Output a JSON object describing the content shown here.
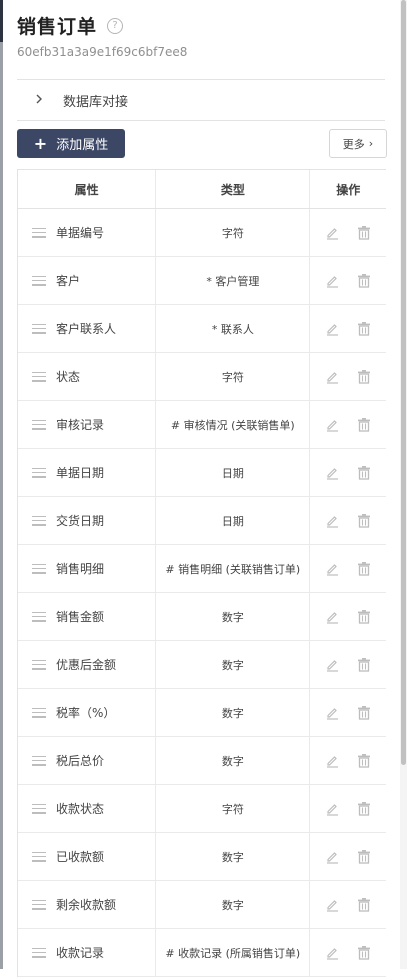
{
  "header": {
    "title": "销售订单",
    "help_icon": "?",
    "record_id": "60efb31a3a9e1f69c6bf7ee8"
  },
  "db_section": {
    "label": "数据库对接",
    "icon": "chevron-right-icon"
  },
  "toolbar": {
    "add_label": "添加属性",
    "add_icon": "+",
    "more_label": "更多",
    "more_icon": "›"
  },
  "table": {
    "headers": {
      "property": "属性",
      "type": "类型",
      "actions": "操作"
    },
    "rows": [
      {
        "name": "单据编号",
        "type": "字符"
      },
      {
        "name": "客户",
        "type": "* 客户管理"
      },
      {
        "name": "客户联系人",
        "type": "* 联系人"
      },
      {
        "name": "状态",
        "type": "字符"
      },
      {
        "name": "审核记录",
        "type": "# 审核情况 (关联销售单)"
      },
      {
        "name": "单据日期",
        "type": "日期"
      },
      {
        "name": "交货日期",
        "type": "日期"
      },
      {
        "name": "销售明细",
        "type": "# 销售明细 (关联销售订单)"
      },
      {
        "name": "销售金额",
        "type": "数字"
      },
      {
        "name": "优惠后金额",
        "type": "数字"
      },
      {
        "name": "税率（%）",
        "type": "数字"
      },
      {
        "name": "税后总价",
        "type": "数字"
      },
      {
        "name": "收款状态",
        "type": "字符"
      },
      {
        "name": "已收款额",
        "type": "数字"
      },
      {
        "name": "剩余收款额",
        "type": "数字"
      },
      {
        "name": "收款记录",
        "type": "# 收款记录 (所属销售订单)"
      }
    ]
  },
  "colors": {
    "primary": "#3c4766",
    "border": "#e3e3e3",
    "icon": "#bdbdbd"
  }
}
